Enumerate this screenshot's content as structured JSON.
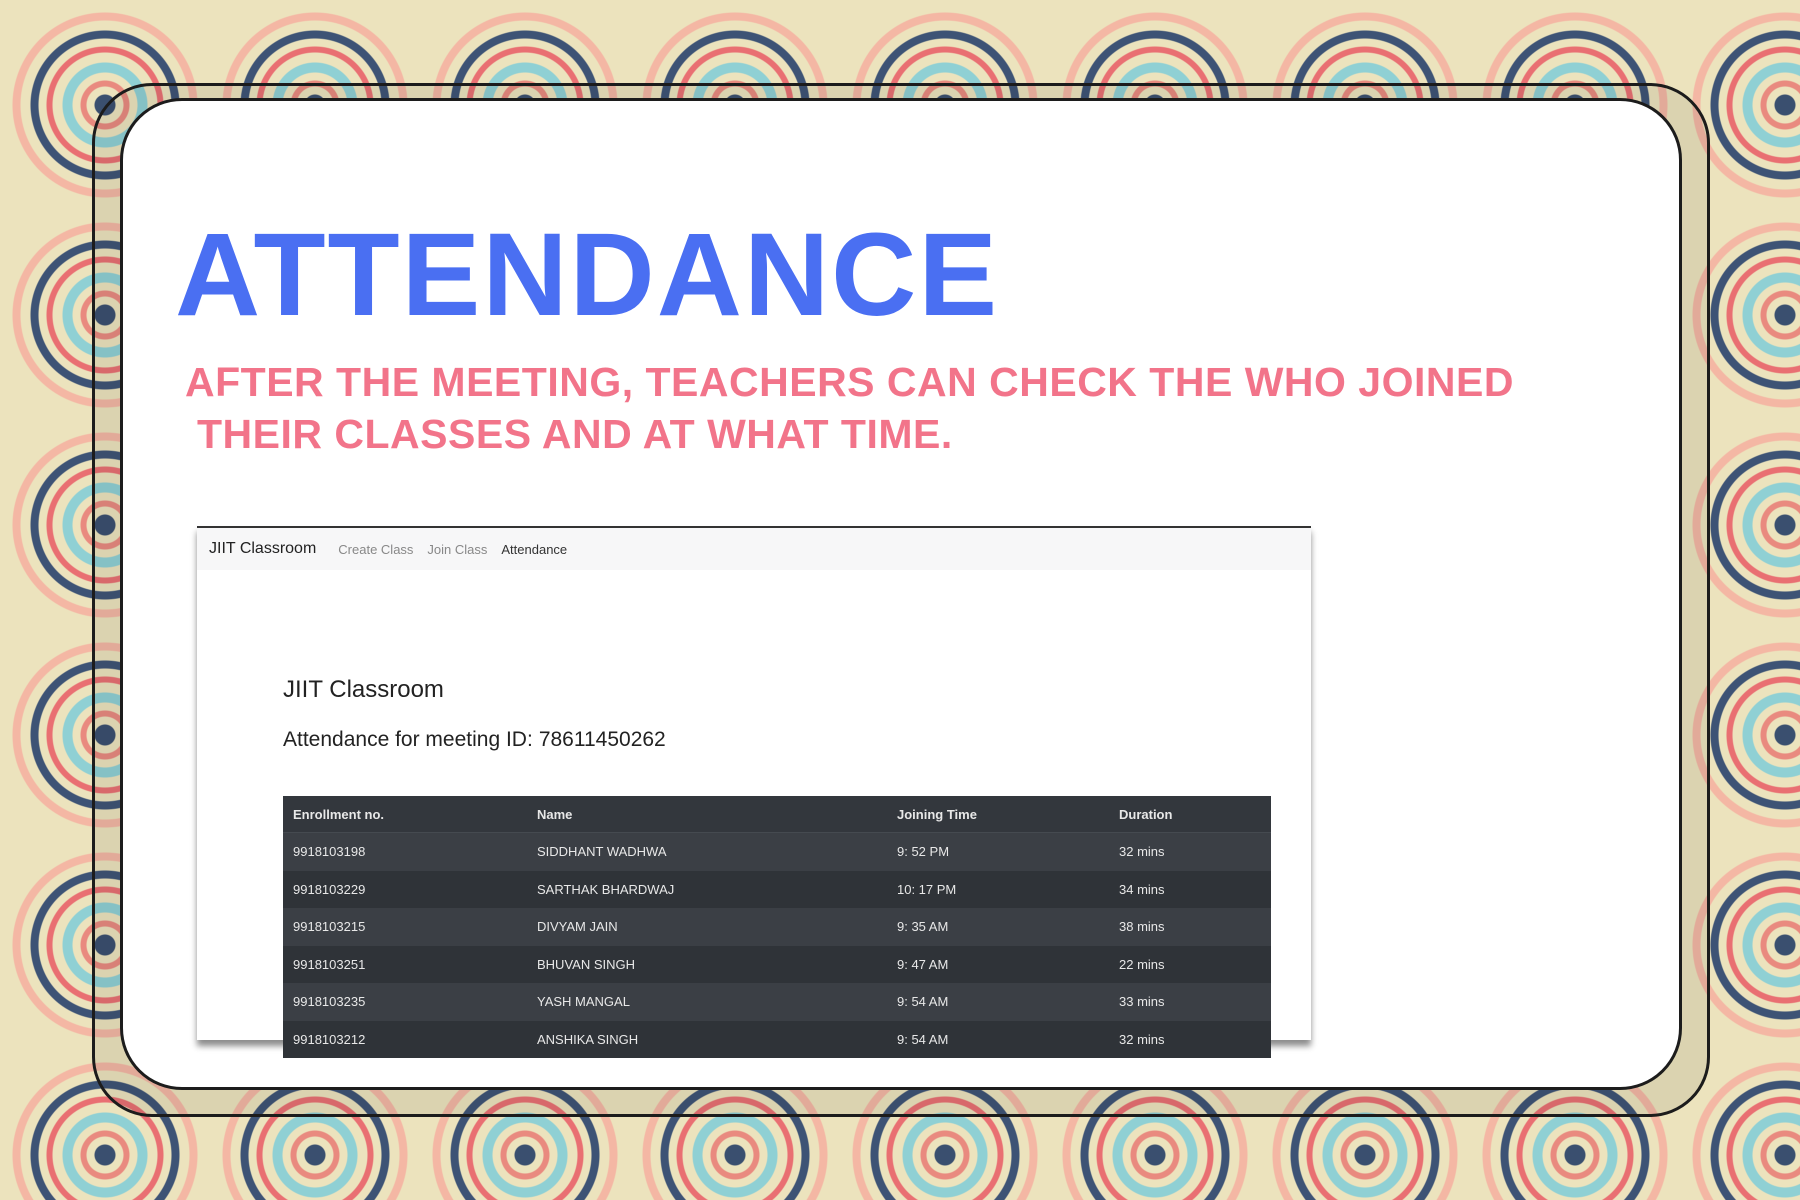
{
  "slide": {
    "title": "ATTENDANCE",
    "subtitle_line1": "AFTER THE MEETING, TEACHERS CAN CHECK THE WHO JOINED",
    "subtitle_line2": "THEIR CLASSES AND AT WHAT TIME.",
    "colors": {
      "title": "#4a6ff2",
      "subtitle": "#f2748a",
      "table_bg": "#2e3238"
    }
  },
  "navbar": {
    "brand": "JIIT Classroom",
    "links": [
      "Create Class",
      "Join Class",
      "Attendance"
    ],
    "active": "Attendance"
  },
  "page": {
    "heading": "JIIT Classroom",
    "meeting_label": "Attendance for meeting ID:",
    "meeting_id": "78611450262"
  },
  "table": {
    "headers": [
      "Enrollment no.",
      "Name",
      "Joining Time",
      "Duration"
    ],
    "rows": [
      [
        "9918103198",
        "SIDDHANT WADHWA",
        "9: 52 PM",
        "32 mins"
      ],
      [
        "9918103229",
        "SARTHAK BHARDWAJ",
        "10: 17 PM",
        "34 mins"
      ],
      [
        "9918103215",
        "DIVYAM JAIN",
        "9: 35 AM",
        "38 mins"
      ],
      [
        "9918103251",
        "BHUVAN SINGH",
        "9: 47 AM",
        "22 mins"
      ],
      [
        "9918103235",
        "YASH MANGAL",
        "9: 54 AM",
        "33 mins"
      ],
      [
        "9918103212",
        "ANSHIKA SINGH",
        "9: 54 AM",
        "32 mins"
      ]
    ]
  }
}
